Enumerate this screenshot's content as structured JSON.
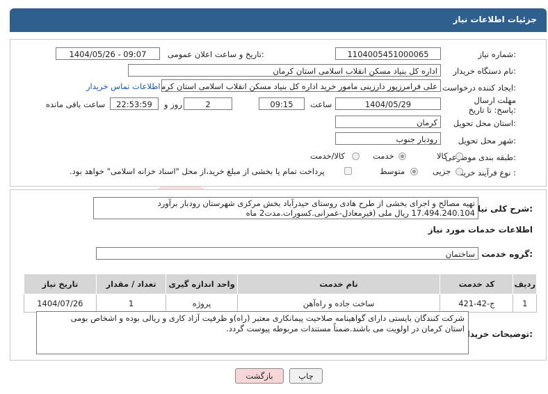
{
  "header": {
    "title": "جزئیات اطلاعات نیاز"
  },
  "form": {
    "need_number_label": "شماره نیاز:",
    "need_number": "1104005451000065",
    "announce_label": "تاریخ و ساعت اعلان عمومی:",
    "announce_value": "1404/05/26 - 09:07",
    "buyer_org_label": "نام دستگاه خریدار:",
    "buyer_org": "اداره کل بنیاد مسکن انقلاب اسلامی استان کرمان",
    "requester_label": "ایجاد کننده درخواست:",
    "requester": "علی فرامرزپور دارزینی مامور خرید اداره کل بنیاد مسکن انقلاب اسلامی استان کرمان",
    "contact_link": "اطلاعات تماس خریدار",
    "deadline_label": "مهلت ارسال پاسخ: تا تاریخ:",
    "deadline_date": "1404/05/29",
    "time_label": "ساعت",
    "deadline_time": "09:15",
    "days_value": "2",
    "days_label": "روز و",
    "remaining_time": "22:53:59",
    "remaining_label": "ساعت باقی مانده",
    "province_label": "استان محل تحویل:",
    "province": "کرمان",
    "city_label": "شهر محل تحویل:",
    "city": "رودبار جنوب",
    "category_label": "طبقه بندی موضوعی:",
    "category_options": [
      "کالا",
      "خدمت",
      "کالا/خدمت"
    ],
    "category_selected": "خدمت",
    "process_label": "نوع فرآیند خرید :",
    "process_options": [
      "جزیی",
      "متوسط"
    ],
    "process_selected": "متوسط",
    "payment_note": "پرداخت تمام یا بخشی از مبلغ خرید،از محل \"اسناد خزانه اسلامی\" خواهد بود."
  },
  "description": {
    "label": "شرح کلی نیاز:",
    "line1": "تهیه مصالح و اجرای بخشی از طرح هادی روستای حیدرآباد بخش مرکزی شهرستان رودبار برآورد",
    "line2": "17.494.240.104 ریال  ملی (فیرمعادل-عمرانی.کسورات.مدت2 ماه"
  },
  "services": {
    "section_title": "اطلاعات خدمات مورد نیاز",
    "group_label": "گروه خدمت:",
    "group_value": "ساختمان",
    "columns": [
      "ردیف",
      "کد خدمت",
      "نام خدمت",
      "واحد اندازه گیری",
      "تعداد / مقدار",
      "تاریخ نیاز"
    ],
    "rows": [
      [
        "1",
        "ج-42-421",
        "ساخت جاده و راه‌آهن",
        "پروژه",
        "1",
        "1404/07/26"
      ]
    ]
  },
  "notes": {
    "label": "توضیحات خریدار:",
    "line1": "شرکت کنندگان بایستی دارای گواهینامه صلاحیت پیمانکاری معتبر (راه)و ظرفیت آزاد کاری و ریالی بوده و اشخاص بومی",
    "line2": "استان کرمان در اولویت می باشند.ضمناً مستندات مربوطه پیوست گردد."
  },
  "buttons": {
    "print": "چاپ",
    "back": "بازگشت"
  },
  "colors": {
    "header_bg": "#2e5f8e",
    "link": "#1a55b5",
    "back_button_bg": "#f7d6da"
  }
}
